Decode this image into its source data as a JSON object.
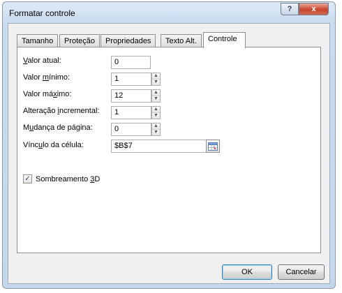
{
  "window": {
    "title": "Formatar controle"
  },
  "titlebar": {
    "help_glyph": "?",
    "close_glyph": "x"
  },
  "tabs": [
    {
      "label": "Tamanho",
      "active": false
    },
    {
      "label": "Proteção",
      "active": false
    },
    {
      "label": "Propriedades",
      "active": false
    },
    {
      "label": "Texto Alt.",
      "active": false
    },
    {
      "label": "Controle",
      "active": true
    }
  ],
  "fields": {
    "valor_atual": {
      "label_pre": "",
      "label_key": "V",
      "label_post": "alor atual:",
      "value": "0"
    },
    "valor_minimo": {
      "label_pre": "Valor ",
      "label_key": "m",
      "label_post": "ínimo:",
      "value": "1"
    },
    "valor_maximo": {
      "label_pre": "Valor má",
      "label_key": "x",
      "label_post": "imo:",
      "value": "12"
    },
    "alteracao_incremental": {
      "label_pre": "Alteração ",
      "label_key": "i",
      "label_post": "ncremental:",
      "value": "1"
    },
    "mudanca_de_pagina": {
      "label_pre": "M",
      "label_key": "u",
      "label_post": "dança de página:",
      "value": "0"
    },
    "vinculo_da_celula": {
      "label_pre": "Vínc",
      "label_key": "u",
      "label_post": "lo da célula:",
      "value": "$B$7"
    }
  },
  "shading": {
    "label_pre": "Sombreamento ",
    "label_key": "3",
    "label_post": "D",
    "checked": true,
    "check_glyph": "✓"
  },
  "buttons": {
    "ok": "OK",
    "cancel": "Cancelar"
  },
  "icons": {
    "help": "help-icon",
    "close": "close-icon",
    "spin": "spin-arrows-icon",
    "cell_ref": "collapse-dialog-icon"
  }
}
